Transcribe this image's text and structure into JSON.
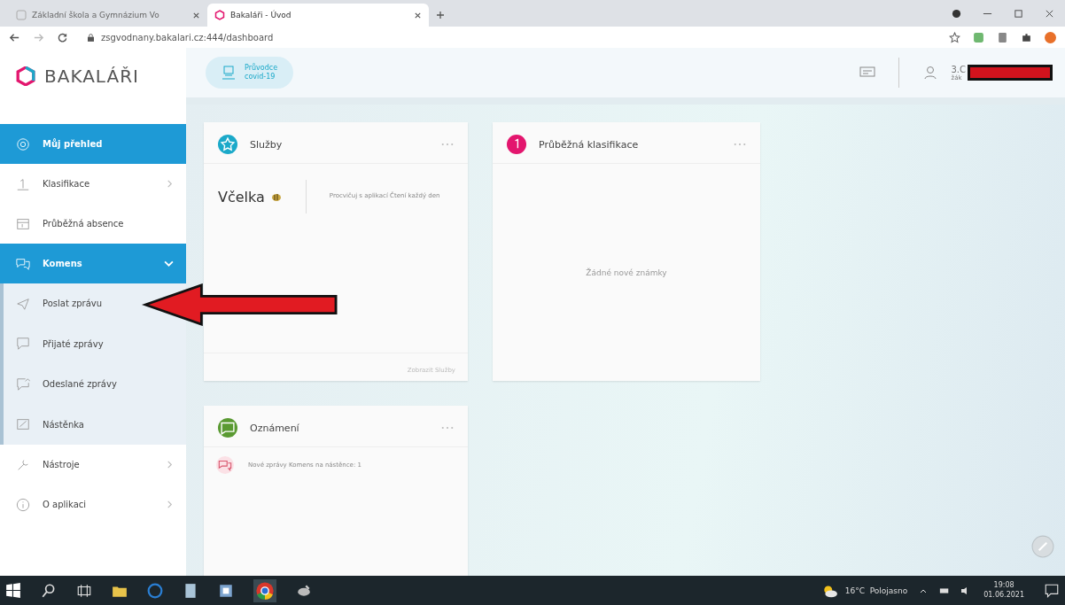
{
  "browser": {
    "tabs": [
      {
        "title": "Základní škola a Gymnázium Vo",
        "selected": false
      },
      {
        "title": "Bakaláři - Úvod",
        "selected": true
      }
    ],
    "url": "zsgvodnany.bakalari.cz:444/dashboard"
  },
  "header": {
    "logo": "BAKALÁŘI",
    "chip": [
      "Průvodce",
      "covid-19"
    ],
    "user_class": "3.C",
    "user_role": "žák"
  },
  "sidebar": {
    "items": [
      {
        "label": "Můj přehled",
        "selected": true
      },
      {
        "label": "Klasifikace",
        "selected": false,
        "expanded": false
      },
      {
        "label": "Průběžná absence",
        "selected": false
      },
      {
        "label": "Komens",
        "selected": true,
        "expanded": true,
        "children": [
          {
            "label": "Poslat zprávu",
            "selected": false
          },
          {
            "label": "Přijaté zprávy",
            "selected": false
          },
          {
            "label": "Odeslané zprávy",
            "selected": false
          },
          {
            "label": "Nástěnka",
            "selected": false
          }
        ]
      },
      {
        "label": "Nástroje",
        "selected": false,
        "expanded": false
      },
      {
        "label": "O aplikaci",
        "selected": false,
        "expanded": false
      }
    ]
  },
  "cards": [
    {
      "kind": "services",
      "title": "Služby",
      "color": "#1ba9c9",
      "service": "Včelka",
      "text": "Procvičuj s aplikací Čtení každý den",
      "footer": "Zobrazit Služby"
    },
    {
      "kind": "empty",
      "title": "Průběžná klasifikace",
      "color": "#e3166e",
      "text": "Žádné nové známky"
    },
    {
      "kind": "list",
      "title": "Oznámení",
      "color": "#5a9a32",
      "text": "Nové zprávy Komens na nástěnce: 1"
    }
  ],
  "taskbar": {
    "weather": "16°C  Polojasno",
    "time": "19:08",
    "date": "01.06.2021"
  }
}
